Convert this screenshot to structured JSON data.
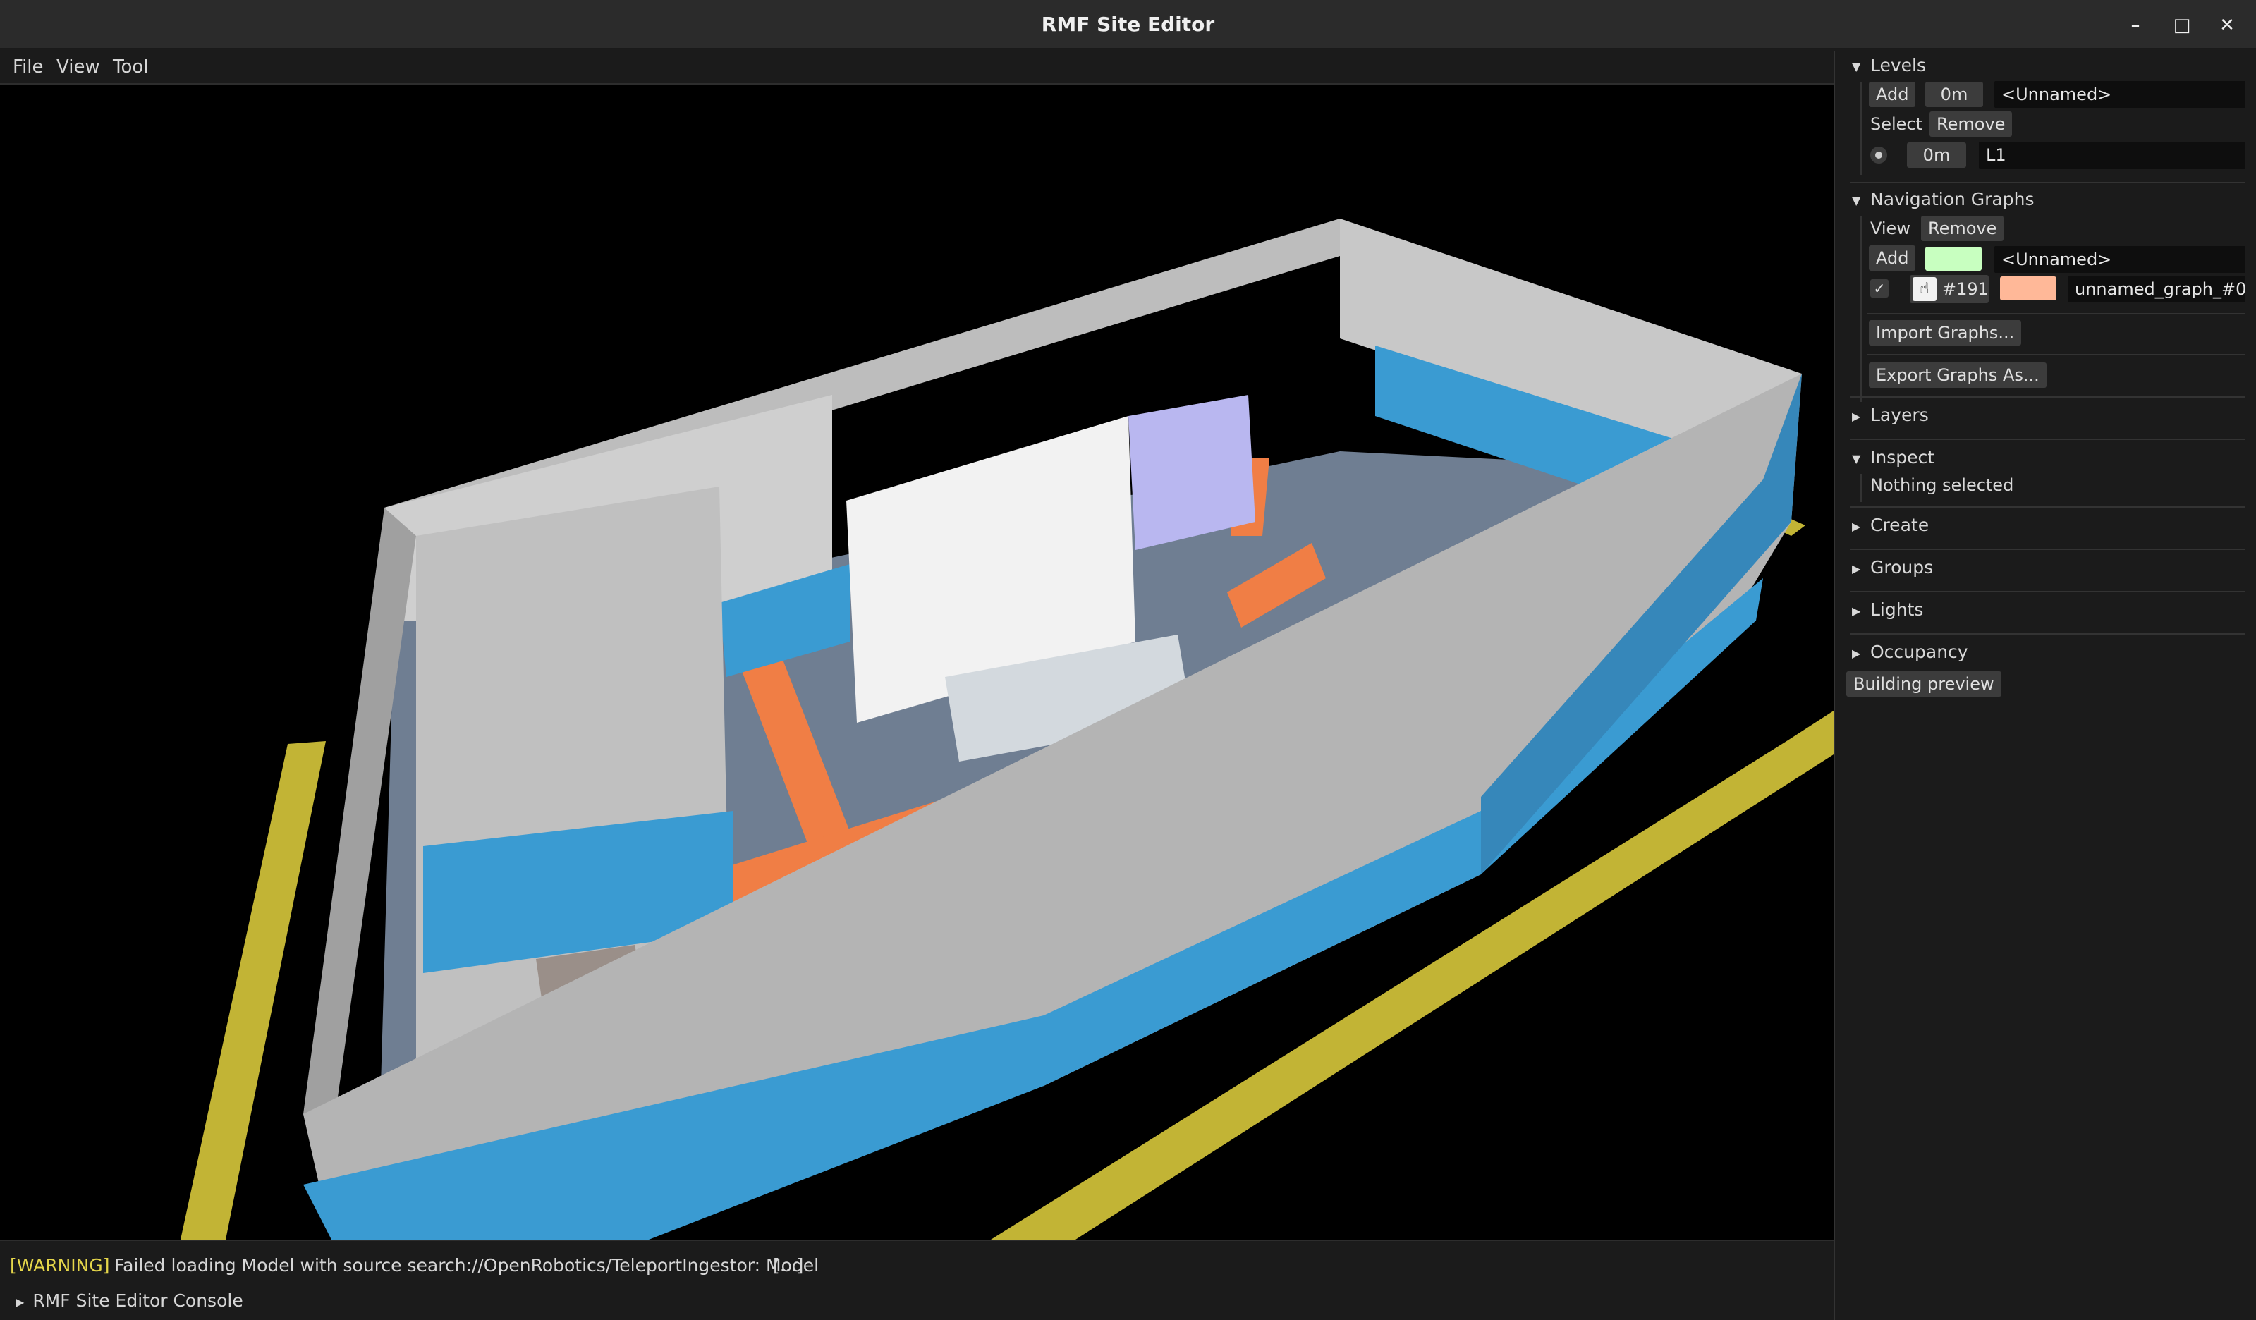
{
  "window": {
    "title": "RMF Site Editor",
    "controls": {
      "minimize": "–",
      "maximize": "□",
      "close": "✕"
    }
  },
  "menu": {
    "file": "File",
    "view": "View",
    "tool": "Tool"
  },
  "viewport": {
    "description_icon": "3d-building-view"
  },
  "console": {
    "warning_tag": "[WARNING]",
    "warning_message": "Failed loading Model with source search://OpenRobotics/TeleportIngestor: Model",
    "more": "[...]",
    "header": "RMF Site Editor Console"
  },
  "panel": {
    "levels": {
      "title": "Levels",
      "add": "Add",
      "new_elevation": "0m",
      "new_name": "<Unnamed>",
      "select": "Select",
      "remove": "Remove",
      "level_elevation": "0m",
      "level_name": "L1"
    },
    "nav_graphs": {
      "title": "Navigation Graphs",
      "view": "View",
      "remove": "Remove",
      "add": "Add",
      "new_name": "<Unnamed>",
      "new_color": "#c8ffc0",
      "graph_id": "#191",
      "graph_color": "#ffb898",
      "graph_name": "unnamed_graph_#0",
      "import": "Import Graphs...",
      "export": "Export Graphs As..."
    },
    "layers": {
      "title": "Layers"
    },
    "inspect": {
      "title": "Inspect",
      "status": "Nothing selected"
    },
    "create": {
      "title": "Create"
    },
    "groups": {
      "title": "Groups"
    },
    "lights": {
      "title": "Lights"
    },
    "occupancy": {
      "title": "Occupancy"
    },
    "building_preview": "Building preview"
  }
}
